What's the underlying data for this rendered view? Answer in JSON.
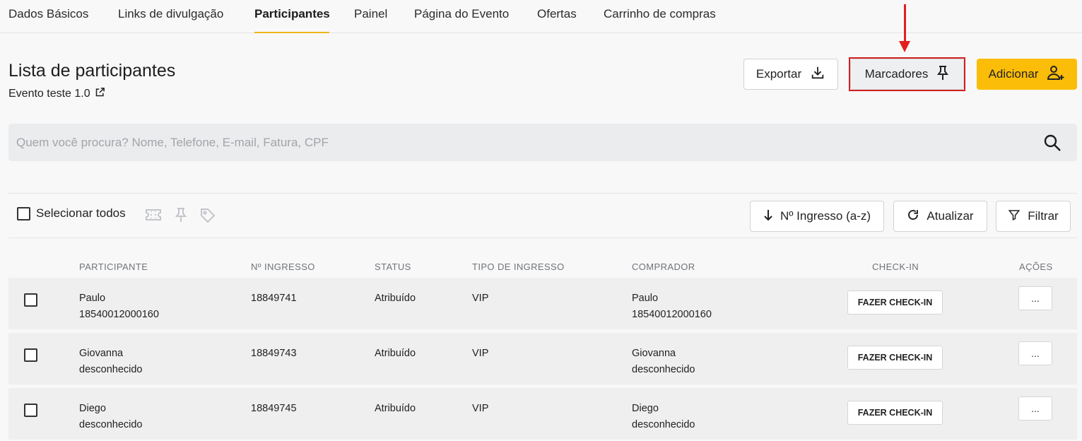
{
  "tabs": [
    {
      "label": "Dados Básicos",
      "active": false
    },
    {
      "label": "Links de divulgação",
      "active": false
    },
    {
      "label": "Participantes",
      "active": true
    },
    {
      "label": "Painel",
      "active": false
    },
    {
      "label": "Página do Evento",
      "active": false
    },
    {
      "label": "Ofertas",
      "active": false
    },
    {
      "label": "Carrinho de compras",
      "active": false
    }
  ],
  "header": {
    "title": "Lista de participantes",
    "event_name": "Evento teste 1.0",
    "export_label": "Exportar",
    "markers_label": "Marcadores",
    "add_label": "Adicionar"
  },
  "search": {
    "placeholder": "Quem você procura? Nome, Telefone, E-mail, Fatura, CPF",
    "value": ""
  },
  "toolbar": {
    "select_all_label": "Selecionar todos",
    "sort_label": "Nº Ingresso (a-z)",
    "refresh_label": "Atualizar",
    "filter_label": "Filtrar"
  },
  "table": {
    "columns": [
      "PARTICIPANTE",
      "Nº INGRESSO",
      "STATUS",
      "TIPO DE INGRESSO",
      "COMPRADOR",
      "CHECK-IN",
      "AÇÕES"
    ],
    "checkin_label": "FAZER CHECK-IN",
    "actions_label": "...",
    "rows": [
      {
        "participant_name": "Paulo",
        "participant_doc": "18540012000160",
        "ticket": "18849741",
        "status": "Atribuído",
        "ticket_type": "VIP",
        "buyer_name": "Paulo",
        "buyer_doc": "18540012000160"
      },
      {
        "participant_name": "Giovanna",
        "participant_doc": "desconhecido",
        "ticket": "18849743",
        "status": "Atribuído",
        "ticket_type": "VIP",
        "buyer_name": "Giovanna",
        "buyer_doc": "desconhecido"
      },
      {
        "participant_name": "Diego",
        "participant_doc": "desconhecido",
        "ticket": "18849745",
        "status": "Atribuído",
        "ticket_type": "VIP",
        "buyer_name": "Diego",
        "buyer_doc": "desconhecido"
      }
    ]
  },
  "colors": {
    "accent": "#fbbd08",
    "tab_underline": "#f0b418",
    "annotation_red": "#e3201b"
  }
}
